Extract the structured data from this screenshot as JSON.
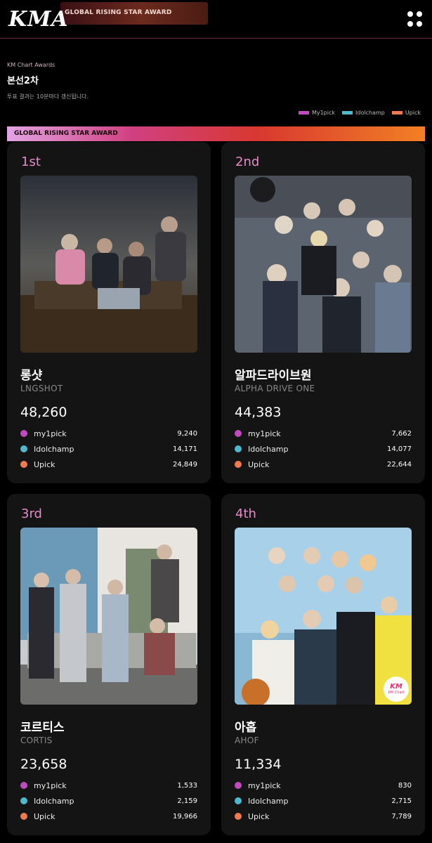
{
  "header": {
    "logo": "KMA",
    "banner": "GLOBAL RISING STAR AWARD",
    "menu_icon": "grid-dots-icon"
  },
  "page": {
    "breadcrumb": "KM Chart Awards",
    "title": "본선2차",
    "note": "투표 결과는 10분마다 갱신됩니다."
  },
  "legend": [
    {
      "label": "My1pick",
      "color": "#c04bc0"
    },
    {
      "label": "Idolchamp",
      "color": "#4fb8cc"
    },
    {
      "label": "Upick",
      "color": "#f07a50"
    }
  ],
  "award_title": "GLOBAL RISING STAR AWARD",
  "cards": [
    {
      "rank": "1st",
      "name_ko": "롱샷",
      "name_en": "LNGSHOT",
      "total": "48,260",
      "votes": [
        {
          "label": "my1pick",
          "value": "9,240"
        },
        {
          "label": "Idolchamp",
          "value": "14,171"
        },
        {
          "label": "Upick",
          "value": "24,849"
        }
      ]
    },
    {
      "rank": "2nd",
      "name_ko": "알파드라이브원",
      "name_en": "ALPHA DRIVE ONE",
      "total": "44,383",
      "votes": [
        {
          "label": "my1pick",
          "value": "7,662"
        },
        {
          "label": "Idolchamp",
          "value": "14,077"
        },
        {
          "label": "Upick",
          "value": "22,644"
        }
      ]
    },
    {
      "rank": "3rd",
      "name_ko": "코르티스",
      "name_en": "CORTIS",
      "total": "23,658",
      "votes": [
        {
          "label": "my1pick",
          "value": "1,533"
        },
        {
          "label": "Idolchamp",
          "value": "2,159"
        },
        {
          "label": "Upick",
          "value": "19,966"
        }
      ]
    },
    {
      "rank": "4th",
      "name_ko": "아홉",
      "name_en": "AHOF",
      "total": "11,334",
      "badge_top": "KM",
      "badge_bottom": "KM Chart",
      "votes": [
        {
          "label": "my1pick",
          "value": "830"
        },
        {
          "label": "Idolchamp",
          "value": "2,715"
        },
        {
          "label": "Upick",
          "value": "7,789"
        }
      ]
    }
  ]
}
